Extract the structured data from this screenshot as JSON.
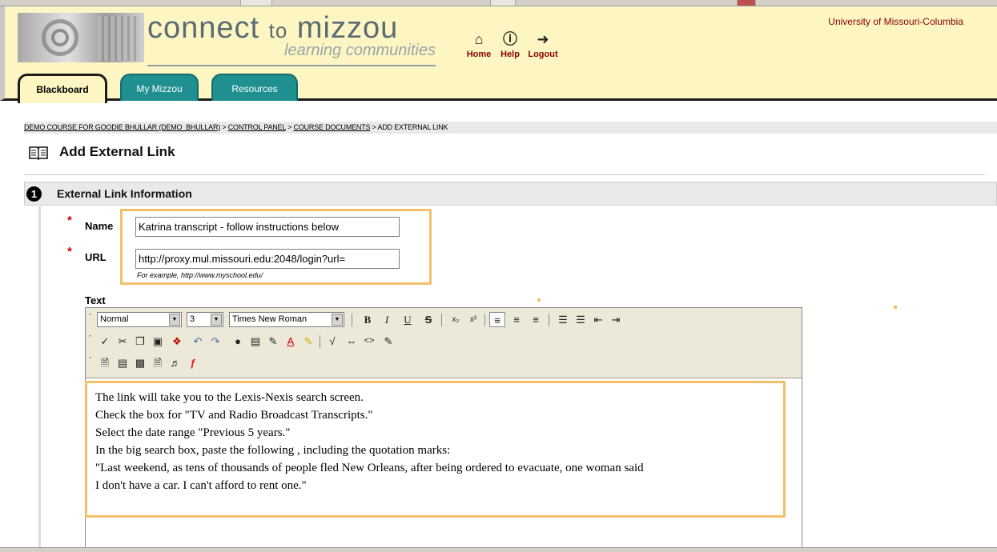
{
  "header": {
    "brand_title_main": "connect",
    "brand_title_to": "to",
    "brand_title_end": "mizzou",
    "brand_subtitle": "learning communities",
    "university": "University of Missouri-Columbia",
    "nav": [
      {
        "label": "Home",
        "icon": "home-icon"
      },
      {
        "label": "Help",
        "icon": "help-icon"
      },
      {
        "label": "Logout",
        "icon": "logout-icon"
      }
    ],
    "tabs": [
      {
        "label": "Blackboard",
        "active": true
      },
      {
        "label": "My Mizzou",
        "active": false
      },
      {
        "label": "Resources",
        "active": false
      }
    ]
  },
  "breadcrumb": {
    "items": [
      "DEMO COURSE FOR GOODIE BHULLAR (DEMO_BHULLAR)",
      "CONTROL PANEL",
      "COURSE DOCUMENTS",
      "ADD EXTERNAL LINK"
    ],
    "separator": ">"
  },
  "page": {
    "title": "Add External Link"
  },
  "section": {
    "number": "1",
    "title": "External Link Information"
  },
  "form": {
    "required_mark": "*",
    "name_label": "Name",
    "name_value": "Katrina transcript - follow instructions below",
    "url_label": "URL",
    "url_value": "http://proxy.mul.missouri.edu:2048/login?url=",
    "url_example": "For example, http://www.myschool.edu/",
    "text_label": "Text"
  },
  "editor": {
    "format_select": "Normal",
    "size_select": "3",
    "font_select": "Times New Roman",
    "body_lines": [
      " The link will take you to the Lexis-Nexis search screen.",
      "Check the box for \"TV and Radio Broadcast Transcripts.\"",
      "Select the date range \"Previous 5 years.\"",
      "In the big search box, paste the following , including the quotation marks:",
      "\"Last weekend, as tens of thousands of people fled New Orleans, after being ordered to evacuate, one woman said",
      "I don't have a car. I can't afford to rent one.\""
    ]
  },
  "colors": {
    "header_bg": "#fdf6c3",
    "tab_teal": "#1f8f8f",
    "highlight": "#f2c06a",
    "required_red": "#cc0000"
  }
}
